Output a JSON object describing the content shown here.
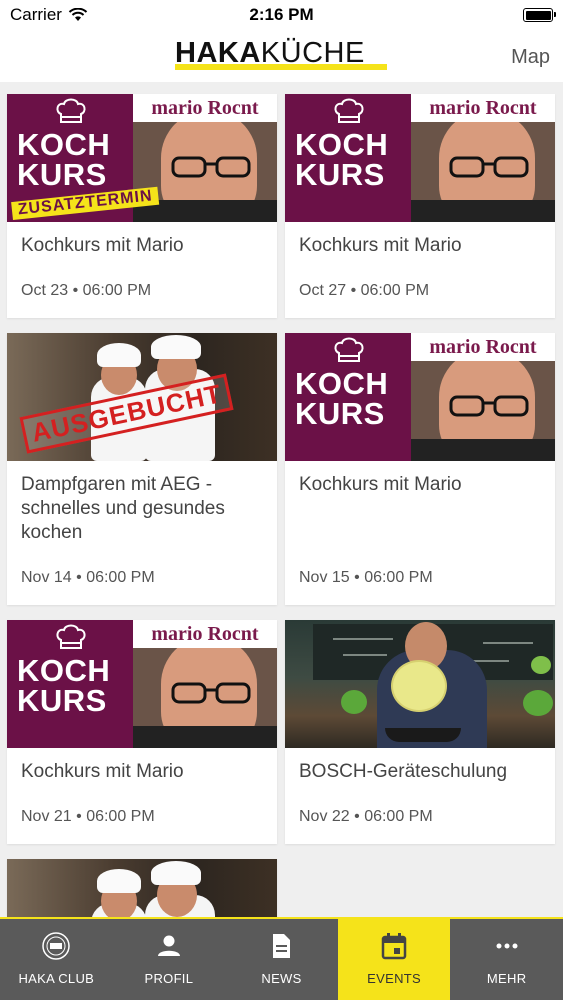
{
  "status_bar": {
    "carrier": "Carrier",
    "time": "2:16 PM"
  },
  "nav": {
    "logo_bold": "HAKA",
    "logo_light": "KÜCHE",
    "right_button": "Map"
  },
  "image_text": {
    "kochkurs_line1": "KOCH",
    "kochkurs_line2": "KURS",
    "mario_brand": "mario Rocnt",
    "zusatztermin": "ZUSATZTERMIN",
    "ausgebucht": "AUSGEBUCHT"
  },
  "events": [
    {
      "title": "Kochkurs mit Mario",
      "date": "Oct 23 • 06:00 PM",
      "image": "kochkurs-zusatztermin"
    },
    {
      "title": "Kochkurs mit Mario",
      "date": "Oct 27 • 06:00 PM",
      "image": "kochkurs"
    },
    {
      "title": "Dampfgaren mit AEG - schnelles und gesundes kochen",
      "date": "Nov 14 • 06:00 PM",
      "image": "chefs-ausgebucht"
    },
    {
      "title": "Kochkurs mit Mario",
      "date": "Nov 15 • 06:00 PM",
      "image": "kochkurs"
    },
    {
      "title": "Kochkurs mit Mario",
      "date": "Nov 21 • 06:00 PM",
      "image": "kochkurs"
    },
    {
      "title": "BOSCH-Geräteschulung",
      "date": "Nov 22 • 06:00 PM",
      "image": "bosch-training"
    },
    {
      "title": "",
      "date": "",
      "image": "chefs"
    }
  ],
  "tabs": [
    {
      "label": "HAKA CLUB",
      "icon": "haka-club-seal-icon",
      "active": false
    },
    {
      "label": "PROFIL",
      "icon": "person-icon",
      "active": false
    },
    {
      "label": "NEWS",
      "icon": "document-icon",
      "active": false
    },
    {
      "label": "EVENTS",
      "icon": "calendar-icon",
      "active": true
    },
    {
      "label": "MEHR",
      "icon": "more-dots-icon",
      "active": false
    }
  ],
  "colors": {
    "accent_yellow": "#f5e31a",
    "kochkurs_purple": "#6b1147",
    "tab_bar": "#5a5a5a"
  }
}
